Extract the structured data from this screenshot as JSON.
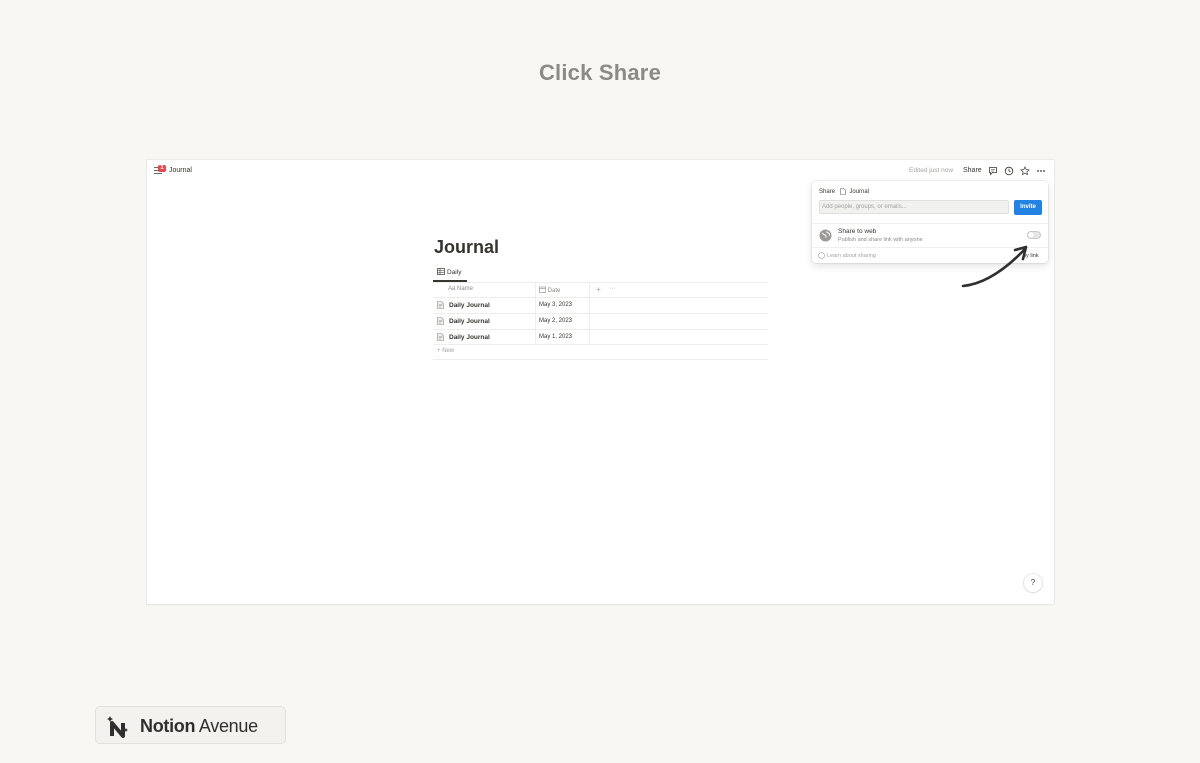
{
  "heading": "Click Share",
  "topbar": {
    "breadcrumb": "Journal",
    "notification_count": "1",
    "edited": "Edited just now",
    "share_label": "Share"
  },
  "share_popover": {
    "title": "Share",
    "page_name": "Journal",
    "input_placeholder": "Add people, groups, or emails...",
    "invite_label": "Invite",
    "share_to_web_title": "Share to web",
    "share_to_web_subtitle": "Publish and share link with anyone",
    "share_to_web_enabled": false,
    "learn_label": "Learn about sharing",
    "copy_link_label": "py link"
  },
  "page": {
    "title": "Journal",
    "view_tab": "Daily",
    "columns": {
      "name": "Name",
      "name_prefix": "Aa",
      "date": "Date"
    },
    "rows": [
      {
        "name": "Daily Journal",
        "date": "May 3, 2023"
      },
      {
        "name": "Daily Journal",
        "date": "May 2, 2023"
      },
      {
        "name": "Daily Journal",
        "date": "May 1, 2023"
      }
    ],
    "new_label": "New",
    "help_label": "?"
  },
  "brand": {
    "strong": "Notion",
    "light": " Avenue"
  },
  "colors": {
    "accent": "#2383e2",
    "badge": "#e5484d",
    "background": "#f8f7f3"
  },
  "icons": [
    "menu-icon",
    "comment-icon",
    "clock-icon",
    "star-icon",
    "more-icon",
    "globe-icon",
    "table-icon",
    "calendar-icon",
    "page-icon",
    "plus-icon"
  ]
}
